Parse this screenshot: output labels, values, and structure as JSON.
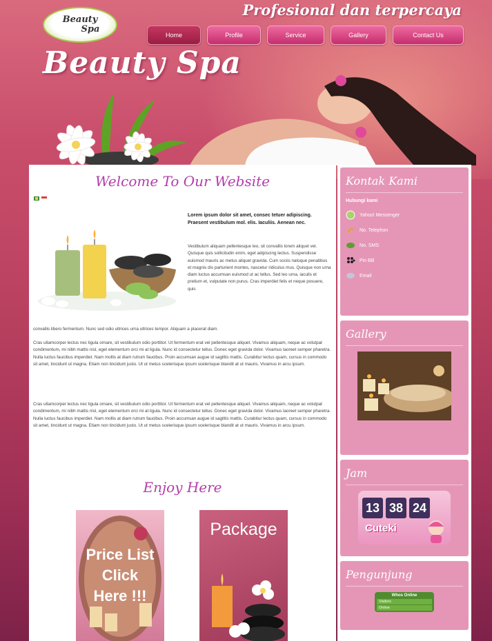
{
  "header": {
    "logo_line1": "Beauty",
    "logo_line2": "Spa",
    "tagline": "Profesional dan terpercaya",
    "brand": "Beauty Spa"
  },
  "nav": [
    {
      "label": "Home",
      "active": true
    },
    {
      "label": "Profile",
      "active": false
    },
    {
      "label": "Service",
      "active": false
    },
    {
      "label": "Gallery",
      "active": false
    },
    {
      "label": "Contact Us",
      "active": false
    }
  ],
  "main": {
    "welcome_title": "Welcome To Our Website",
    "lead": "Lorem ipsum dolor sit amet, consec tetuer adipiscing. Praesent vestibulum mol. elis. Iaculiis. Aenean nec.",
    "para1": "Vestibulum aliquam pellentesque leo, sit convallis lorem aliquet vel. Quisque quis sollicitudin enim, eget adipiscing lectus. Suspendisse euismod mauris ac metus aliquet gravida. Cum sociis natoque penatibus et magnis dis parturient montes, nascetur ridiculus mus. Quisque non urna diam luctus accumsan euismod ut ac tellus. Sed leo urna, iaculis et pretium et, vulputate non purus. Cras imperdiet felis et neque posuere, quis",
    "para1_cont": "convallis libero fermentum. Nunc sed odio ultrices urna ultrices tempor. Aliquam a placerat diam.",
    "para2": "Cras ullamcorper lectus nec ligula ornare, sit vestibulum odio porttitor. Ut fermentum erat vel pellentesque aliquet. Vivamus aliquam, neque ac volutpat condimentum, mi nibh mattis nisl, eget elementum orci mi at ligula. Nunc id consectetur tellus. Donec eget gravida dolor. Vivamus laoreet semper pharetra. Nulla luctus faucibus imperdiet. Nam mollis at diam rutrum faucibus. Proin accumsan augue id sagittis mattis. Curabitur lectus quam, cursus in commodo sit amet, tincidunt ut magna. Etiam non tincidunt justo. Ut ut metus scelerisque ipsum scelerisque blandit at ut mauris. Vivamus in arcu ipsum.",
    "para3": "Cras ullamcorper lectus nec ligula ornare, sit vestibulum odio porttitor. Ut fermentum erat vel pellentesque aliquet. Vivamus aliquam, neque ac volutpat condimentum, mi nibh mattis nisl, eget elementum orci mi at ligula. Nunc id consectetur tellus. Donec eget gravida dolor. Vivamus laoreet semper pharetra. Nulla luctus faucibus imperdiet. Nam mollis at diam rutrum faucibus. Proin accumsan augue id sagittis mattis. Curabitur lectus quam, cursus in commodo sit amet, tincidunt ut magna. Etiam non tincidunt justo. Ut ut metus scelerisque ipsum scelerisque blandit at ut mauris. Vivamus in arcu ipsum.",
    "enjoy_title": "Enjoy Here",
    "price_list_line1": "Price List",
    "price_list_line2": "Click",
    "price_list_line3": "Here !!!",
    "package_label": "Package"
  },
  "sidebar": {
    "contact_title": "Kontak Kami",
    "contact_head": "Hubungi kami",
    "contacts": [
      {
        "label": "Yahoo! Messenger",
        "icon": "messenger-icon",
        "color": "#a7d46b"
      },
      {
        "label": "No. Telephon",
        "icon": "phone-icon",
        "color": "#e7a13a"
      },
      {
        "label": "No. SMS",
        "icon": "sms-icon",
        "color": "#5aa02c"
      },
      {
        "label": "Pin BB",
        "icon": "blackberry-icon",
        "color": "#222222"
      },
      {
        "label": "Email",
        "icon": "email-icon",
        "color": "#bfc8d6"
      }
    ],
    "gallery_title": "Gallery",
    "clock_title": "Jam",
    "clock": {
      "hours": "13",
      "minutes": "38",
      "seconds": "24",
      "brand": "Cuteki"
    },
    "visitors_title": "Pengunjung",
    "visitors": {
      "header": "Whos Online",
      "row1": "Visitors",
      "row2": "Online"
    }
  },
  "colors": {
    "accent": "#b23dab",
    "panel": "#e596b6",
    "nav": "#d63f7e"
  }
}
